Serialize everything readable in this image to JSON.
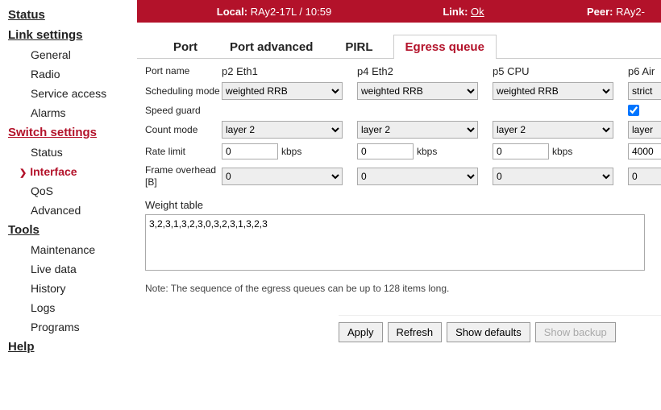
{
  "sidebar": {
    "groups": [
      {
        "title": "Status",
        "red": false,
        "items": []
      },
      {
        "title": "Link settings",
        "red": false,
        "items": [
          "General",
          "Radio",
          "Service access",
          "Alarms"
        ]
      },
      {
        "title": "Switch settings",
        "red": true,
        "items": [
          "Status",
          "Interface",
          "QoS",
          "Advanced"
        ]
      },
      {
        "title": "Tools",
        "red": false,
        "items": [
          "Maintenance",
          "Live data",
          "History",
          "Logs",
          "Programs"
        ]
      },
      {
        "title": "Help",
        "red": false,
        "items": []
      }
    ],
    "selected": "Interface"
  },
  "topbar": {
    "local_label": "Local:",
    "local_value": "RAy2-17L / 10:59",
    "link_label": "Link:",
    "link_value": "Ok",
    "peer_label": "Peer:",
    "peer_value": "RAy2-"
  },
  "tabs": [
    "Port",
    "Port advanced",
    "PIRL",
    "Egress queue"
  ],
  "active_tab": "Egress queue",
  "rows": {
    "port_name_label": "Port name",
    "scheduling_label": "Scheduling mode",
    "speed_guard_label": "Speed guard",
    "count_mode_label": "Count mode",
    "rate_limit_label": "Rate limit",
    "frame_overhead_label": "Frame overhead [B]",
    "unit_kbps": "kbps"
  },
  "ports": [
    {
      "name": "p2 Eth1",
      "scheduling": "weighted RRB",
      "speed_guard": false,
      "count": "layer 2",
      "rate": "0",
      "frame": "0"
    },
    {
      "name": "p4 Eth2",
      "scheduling": "weighted RRB",
      "speed_guard": false,
      "count": "layer 2",
      "rate": "0",
      "frame": "0"
    },
    {
      "name": "p5 CPU",
      "scheduling": "weighted RRB",
      "speed_guard": false,
      "count": "layer 2",
      "rate": "0",
      "frame": "0"
    },
    {
      "name": "p6 Air",
      "scheduling": "strict",
      "speed_guard": true,
      "count": "layer",
      "rate": "4000",
      "frame": "0"
    }
  ],
  "weight": {
    "label": "Weight table",
    "value": "3,2,3,1,3,2,3,0,3,2,3,1,3,2,3",
    "note": "Note: The sequence of the egress queues can be up to 128 items long."
  },
  "buttons": {
    "apply": "Apply",
    "refresh": "Refresh",
    "defaults": "Show defaults",
    "backup": "Show backup"
  }
}
